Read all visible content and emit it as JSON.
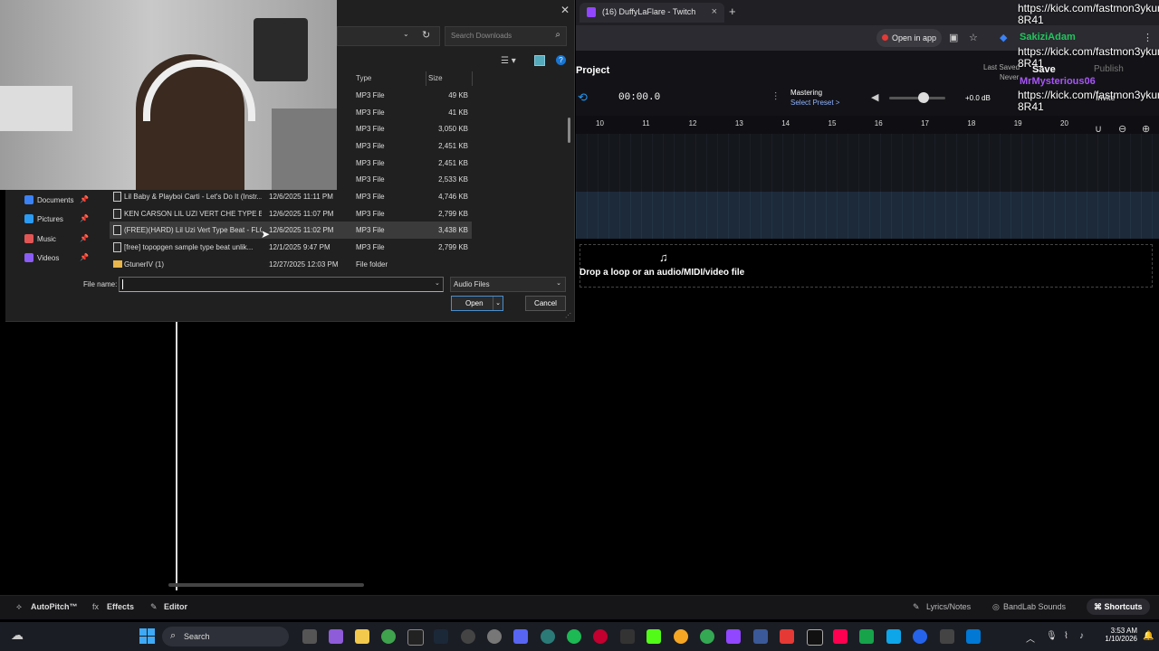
{
  "browser": {
    "tab_title": "(16) DuffyLaFlare - Twitch",
    "open_in_app": "Open in app"
  },
  "daw": {
    "project_title": "Project",
    "time": "00:00.0",
    "mastering_title": "Mastering",
    "mastering_preset": "Select Preset >",
    "volume_db": "+0.0 dB",
    "volume_level": 0.62,
    "last_saved_label": "Last Saved",
    "last_saved_value": "Never",
    "save_label": "Save",
    "publish_label": "Publish",
    "invite_label": "Invite",
    "ruler_ticks": [
      "10",
      "11",
      "12",
      "13",
      "14",
      "15",
      "16",
      "17",
      "18",
      "19",
      "20"
    ],
    "drop_text": "Drop a loop or an audio/MIDI/video file",
    "footer": {
      "autopitch": "AutoPitch™",
      "effects": "Effects",
      "editor": "Editor",
      "lyrics": "Lyrics/Notes",
      "bandlab_sounds": "BandLab Sounds",
      "shortcuts": "Shortcuts"
    }
  },
  "chat": {
    "link1": "https://kick.com/fastmon3ykun",
    "link1_cont": "8R41",
    "user1": "SakiziAdam",
    "link2": "https://kick.com/fastmon3ykun",
    "link2_cont": "8R41",
    "user2": "MrMysterious06",
    "link3": "https://kick.com/fastmon3ykun",
    "link3_cont": "8R41"
  },
  "dialog": {
    "search_placeholder": "Search Downloads",
    "columns": {
      "type": "Type",
      "size": "Size"
    },
    "nav": [
      {
        "label": "Documents",
        "color": "#3b82f6"
      },
      {
        "label": "Pictures",
        "color": "#2b9af3"
      },
      {
        "label": "Music",
        "color": "#e25555"
      },
      {
        "label": "Videos",
        "color": "#8b5cf6"
      }
    ],
    "files": [
      {
        "name": "",
        "date": "",
        "type": "MP3 File",
        "size": "49 KB"
      },
      {
        "name": "",
        "date": "",
        "type": "MP3 File",
        "size": "41 KB"
      },
      {
        "name": "",
        "date": "",
        "type": "MP3 File",
        "size": "3,050 KB"
      },
      {
        "name": "",
        "date": "",
        "type": "MP3 File",
        "size": "2,451 KB"
      },
      {
        "name": "",
        "date": "",
        "type": "MP3 File",
        "size": "2,451 KB"
      },
      {
        "name": "",
        "date": "",
        "type": "MP3 File",
        "size": "2,533 KB"
      },
      {
        "name": "Lil Baby & Playboi Carti - Let's Do It (Instr...",
        "date": "12/6/2025 11:11 PM",
        "type": "MP3 File",
        "size": "4,746 KB"
      },
      {
        "name": "KEN CARSON  LIL UZI VERT  CHE TYPE B...",
        "date": "12/6/2025 11:07 PM",
        "type": "MP3 File",
        "size": "2,799 KB"
      },
      {
        "name": "(FREE)(HARD) Lil Uzi Vert Type Beat - FLO...",
        "date": "12/6/2025 11:02 PM",
        "type": "MP3 File",
        "size": "3,438 KB"
      },
      {
        "name": "[free]  topopgen sample type beat unlik...",
        "date": "12/1/2025 9:47 PM",
        "type": "MP3 File",
        "size": "2,799 KB"
      },
      {
        "name": "GtunerIV (1)",
        "date": "12/27/2025 12:03 PM",
        "type": "File folder",
        "size": ""
      }
    ],
    "file_name_label": "File name:",
    "file_name_value": "",
    "filter_value": "Audio Files",
    "open_label": "Open",
    "cancel_label": "Cancel"
  },
  "taskbar": {
    "search_label": "Search",
    "time": "3:53 AM",
    "date": "1/10/2026"
  },
  "colors": {
    "accent": "#2196f3",
    "chat_green": "#22c55e",
    "chat_purple": "#a855f7",
    "twitch_purple": "#9146ff"
  }
}
